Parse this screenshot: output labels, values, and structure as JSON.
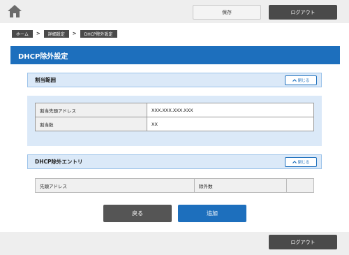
{
  "header": {
    "home_icon": "home-icon",
    "save_label": "保存",
    "logout_label": "ログアウト"
  },
  "breadcrumb": [
    "ホーム",
    "詳細設定",
    "DHCP除外設定"
  ],
  "page_title": "DHCP除外設定",
  "assign_range": {
    "title": "割当範囲",
    "close_label": "閉じる",
    "rows": [
      {
        "label": "割当先頭アドレス",
        "value": "XXX.XXX.XXX.XXX"
      },
      {
        "label": "割当数",
        "value": "XX"
      }
    ]
  },
  "exclusion_entries": {
    "title": "DHCP除外エントリ",
    "close_label": "閉じる",
    "columns": [
      "先頭アドレス",
      "除外数",
      ""
    ]
  },
  "actions": {
    "back_label": "戻る",
    "add_label": "追加"
  },
  "footer": {
    "logout_label": "ログアウト"
  },
  "colors": {
    "accent": "#1d6fbd",
    "dark_button": "#4a4a4a",
    "panel": "#dbe9f8"
  }
}
